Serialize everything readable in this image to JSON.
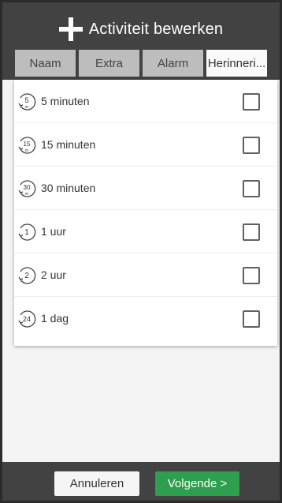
{
  "header": {
    "title": "Activiteit bewerken",
    "tabs": [
      {
        "label": "Naam",
        "active": false
      },
      {
        "label": "Extra",
        "active": false
      },
      {
        "label": "Alarm",
        "active": false
      },
      {
        "label": "Herinneri...",
        "active": true
      }
    ]
  },
  "reminders": [
    {
      "label": "5 minuten",
      "icon_number": "5",
      "checked": false
    },
    {
      "label": "15 minuten",
      "icon_number": "15",
      "checked": false
    },
    {
      "label": "30 minuten",
      "icon_number": "30",
      "checked": false
    },
    {
      "label": "1 uur",
      "icon_number": "1",
      "checked": false
    },
    {
      "label": "2 uur",
      "icon_number": "2",
      "checked": false
    },
    {
      "label": "1 dag",
      "icon_number": "24",
      "checked": false
    }
  ],
  "footer": {
    "cancel_label": "Annuleren",
    "next_label": "Volgende >"
  },
  "colors": {
    "header_bg": "#424242",
    "next_button": "#2e9e4f"
  }
}
